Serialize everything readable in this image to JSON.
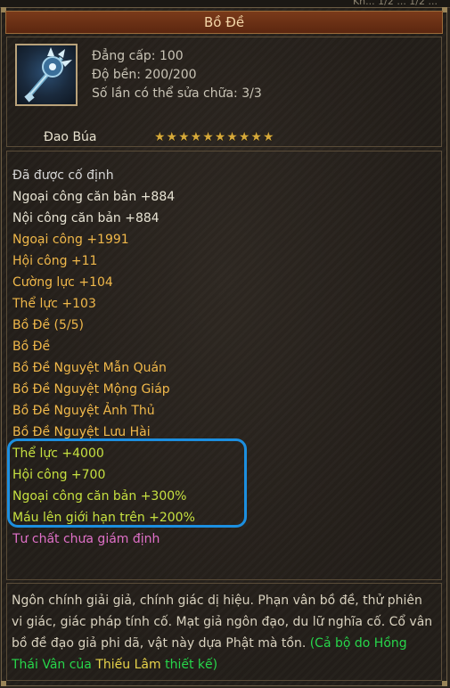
{
  "window": {
    "topstrip_text": "Kh... 1/2 ... 1/2 ..."
  },
  "item": {
    "name": "Bồ Đề",
    "icon": "trident-weapon-icon",
    "stats": [
      "Đẳng cấp: 100",
      "Độ bền: 200/200",
      "Số lần có thể sửa chữa: 3/3"
    ],
    "weapon_class": "Đao Búa",
    "stars": "★★★★★★★★★★",
    "star_count": 10
  },
  "attributes": [
    {
      "text": "Đã được cố định",
      "color": "#d8d8d8"
    },
    {
      "text": "Ngoại công căn bản +884",
      "color": "#e8e4d4"
    },
    {
      "text": "Nội công căn bản +884",
      "color": "#e8e4d4"
    },
    {
      "text": "Ngoại công +1991",
      "color": "#f0b84a"
    },
    {
      "text": "Hội công +11",
      "color": "#f0b84a"
    },
    {
      "text": "Cường lực +104",
      "color": "#f0b84a"
    },
    {
      "text": "Thể lực +103",
      "color": "#f0b84a"
    },
    {
      "text": "Bồ Đề (5/5)",
      "color": "#f0b84a"
    },
    {
      "text": "Bồ Đề",
      "color": "#f0b84a"
    },
    {
      "text": "Bồ Đề Nguyệt Mẫn Quán",
      "color": "#f0b84a"
    },
    {
      "text": "Bồ Đề Nguyệt Mộng Giáp",
      "color": "#f0b84a"
    },
    {
      "text": "Bồ Đề Nguyệt Ảnh Thủ",
      "color": "#f0b84a"
    },
    {
      "text": "Bồ Đề Nguyệt Lưu Hài",
      "color": "#f0b84a"
    },
    {
      "text": "Thể lực +4000",
      "color": "#c6e040"
    },
    {
      "text": "Hội công +700",
      "color": "#c6e040"
    },
    {
      "text": "Ngoại công căn bản +300%",
      "color": "#c6e040"
    },
    {
      "text": "Máu lên giới hạn trên +200%",
      "color": "#c6e040"
    },
    {
      "text": "Tư chất chưa giám định",
      "color": "#e070c8"
    }
  ],
  "description": {
    "text": "Ngôn chính giải giả, chính giác dị hiệu. Phạn vân bồ đề, thử phiên vi giác, giác pháp tính cố. Mạt giả ngôn đạo, du lữ nghĩa cố. Cổ vân bồ đề đạo giả phi dã, vật này dựa Phật mà tồn. ",
    "credit_prefix": "(Cả bộ do Hồng Thái Vân của ",
    "credit_sect": "Thiếu Lâm",
    "credit_suffix": " thiết kế)"
  },
  "colors": {
    "highlight_box": "#1c8fe0",
    "title_bar": "#6a2f14",
    "stars": "#d6a93a"
  }
}
